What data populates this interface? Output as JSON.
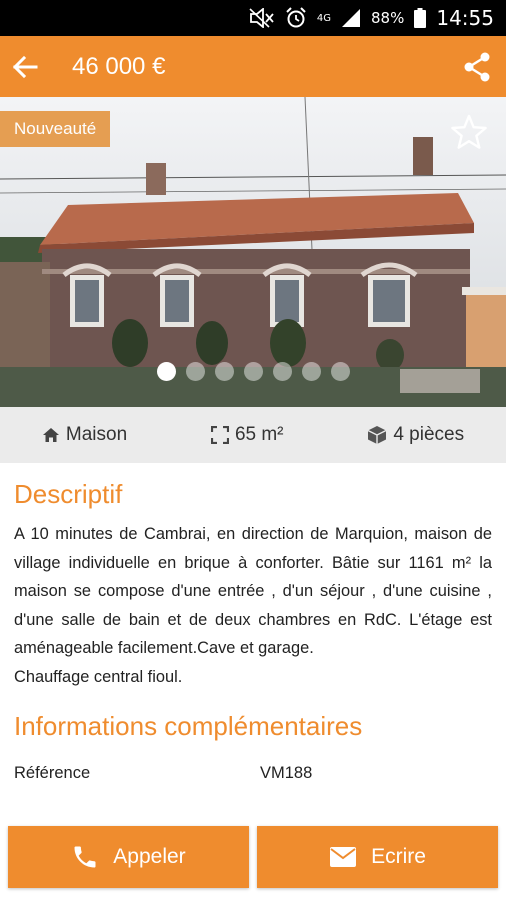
{
  "status_bar": {
    "network": "4G",
    "battery": "88%",
    "time": "14:55"
  },
  "app_bar": {
    "price": "46 000 €"
  },
  "photo": {
    "badge": "Nouveauté",
    "slide_count": 7,
    "active_slide": 1
  },
  "features": {
    "type": "Maison",
    "surface": "65 m²",
    "rooms": "4 pièces"
  },
  "description": {
    "title": "Descriptif",
    "text": "A 10 minutes de Cambrai, en direction de Marquion, maison de village individuelle en brique à conforter. Bâtie sur 1161 m² la maison se compose d'une entrée , d'un séjour , d'une cuisine , d'une salle de bain et de deux chambres en RdC. L'étage est aménageable facilement.Cave et garage.\nChauffage central fioul."
  },
  "info": {
    "title": "Informations complémentaires",
    "rows": [
      {
        "label": "Référence",
        "value": "VM188"
      }
    ]
  },
  "actions": {
    "call_label": "Appeler",
    "write_label": "Ecrire"
  },
  "colors": {
    "accent": "#ef8c2e",
    "badge": "#e59a4a",
    "feature_bar": "#ebebeb"
  }
}
